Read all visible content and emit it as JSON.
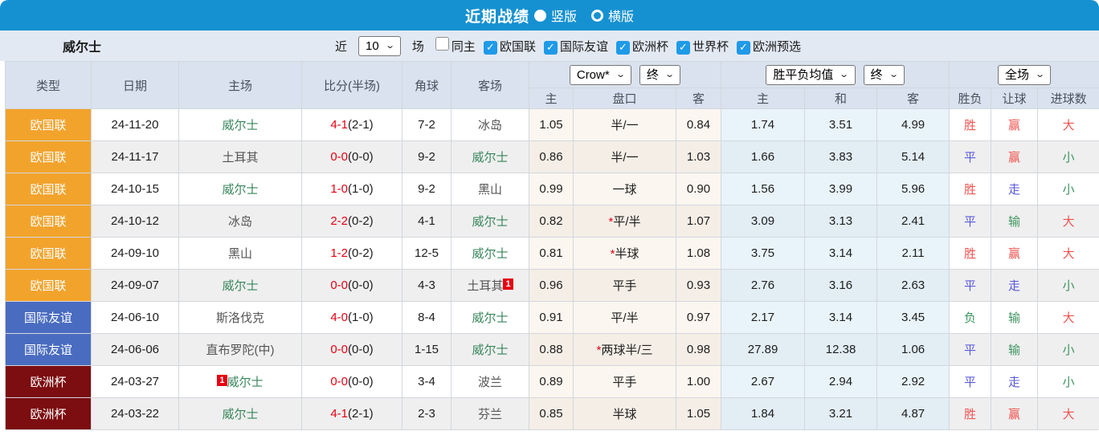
{
  "topbar": {
    "title": "近期战绩",
    "radios": [
      {
        "label": "竖版",
        "selected": true
      },
      {
        "label": "横版",
        "selected": false
      }
    ]
  },
  "filter": {
    "team": "威尔士",
    "near_label": "近",
    "count_select": "10",
    "matches_label": "场",
    "checkboxes": [
      {
        "label": "同主",
        "checked": false
      },
      {
        "label": "欧国联",
        "checked": true
      },
      {
        "label": "国际友谊",
        "checked": true
      },
      {
        "label": "欧洲杯",
        "checked": true
      },
      {
        "label": "世界杯",
        "checked": true
      },
      {
        "label": "欧洲预选",
        "checked": true
      }
    ]
  },
  "colors": {
    "topbar_blue": "#1591d2",
    "checkbox_blue": "#1e9ae8",
    "team_green": "#38865b",
    "score_red": "#e60012",
    "badge_red": "#e60012",
    "result": {
      "red": "#ef5350",
      "blue": "#5a5ae0",
      "green": "#3d9560"
    },
    "type": {
      "欧国联": "#f2a32c",
      "国际友谊": "#4a6cc0",
      "欧洲杯": "#7c0d10"
    }
  },
  "table": {
    "static_headers": [
      "类型",
      "日期",
      "主场",
      "比分(半场)",
      "角球",
      "客场"
    ],
    "odds_group": {
      "selects": [
        "Crow*",
        "终"
      ],
      "sub": [
        "主",
        "盘口",
        "客"
      ]
    },
    "avg_group": {
      "selects": [
        "胜平负均值",
        "终"
      ],
      "sub": [
        "主",
        "和",
        "客"
      ]
    },
    "result_group": {
      "selects": [
        "全场"
      ],
      "sub": [
        "胜负",
        "让球",
        "进球数"
      ]
    },
    "rows": [
      {
        "type": "欧国联",
        "date": "24-11-20",
        "home": {
          "name": "威尔士",
          "team": true
        },
        "score": {
          "full": "4-1",
          "half": "(2-1)"
        },
        "corner": "7-2",
        "away": {
          "name": "冰岛",
          "team": false
        },
        "odds": {
          "home": "1.05",
          "handicap": "半/一",
          "star": false,
          "away": "0.84"
        },
        "avg": {
          "home": "1.74",
          "draw": "3.51",
          "away": "4.99"
        },
        "result": {
          "wdl": {
            "text": "胜",
            "color": "red"
          },
          "handicap": {
            "text": "赢",
            "color": "red"
          },
          "goals": {
            "text": "大",
            "color": "red"
          }
        }
      },
      {
        "type": "欧国联",
        "date": "24-11-17",
        "home": {
          "name": "土耳其",
          "team": false
        },
        "score": {
          "full": "0-0",
          "half": "(0-0)"
        },
        "corner": "9-2",
        "away": {
          "name": "威尔士",
          "team": true
        },
        "odds": {
          "home": "0.86",
          "handicap": "半/一",
          "star": false,
          "away": "1.03"
        },
        "avg": {
          "home": "1.66",
          "draw": "3.83",
          "away": "5.14"
        },
        "result": {
          "wdl": {
            "text": "平",
            "color": "blue"
          },
          "handicap": {
            "text": "赢",
            "color": "red"
          },
          "goals": {
            "text": "小",
            "color": "green"
          }
        }
      },
      {
        "type": "欧国联",
        "date": "24-10-15",
        "home": {
          "name": "威尔士",
          "team": true
        },
        "score": {
          "full": "1-0",
          "half": "(1-0)"
        },
        "corner": "9-2",
        "away": {
          "name": "黑山",
          "team": false
        },
        "odds": {
          "home": "0.99",
          "handicap": "一球",
          "star": false,
          "away": "0.90"
        },
        "avg": {
          "home": "1.56",
          "draw": "3.99",
          "away": "5.96"
        },
        "result": {
          "wdl": {
            "text": "胜",
            "color": "red"
          },
          "handicap": {
            "text": "走",
            "color": "blue"
          },
          "goals": {
            "text": "小",
            "color": "green"
          }
        }
      },
      {
        "type": "欧国联",
        "date": "24-10-12",
        "home": {
          "name": "冰岛",
          "team": false
        },
        "score": {
          "full": "2-2",
          "half": "(0-2)"
        },
        "corner": "4-1",
        "away": {
          "name": "威尔士",
          "team": true
        },
        "odds": {
          "home": "0.82",
          "handicap": "平/半",
          "star": true,
          "away": "1.07"
        },
        "avg": {
          "home": "3.09",
          "draw": "3.13",
          "away": "2.41"
        },
        "result": {
          "wdl": {
            "text": "平",
            "color": "blue"
          },
          "handicap": {
            "text": "输",
            "color": "green"
          },
          "goals": {
            "text": "大",
            "color": "red"
          }
        }
      },
      {
        "type": "欧国联",
        "date": "24-09-10",
        "home": {
          "name": "黑山",
          "team": false
        },
        "score": {
          "full": "1-2",
          "half": "(0-2)"
        },
        "corner": "12-5",
        "away": {
          "name": "威尔士",
          "team": true
        },
        "odds": {
          "home": "0.81",
          "handicap": "半球",
          "star": true,
          "away": "1.08"
        },
        "avg": {
          "home": "3.75",
          "draw": "3.14",
          "away": "2.11"
        },
        "result": {
          "wdl": {
            "text": "胜",
            "color": "red"
          },
          "handicap": {
            "text": "赢",
            "color": "red"
          },
          "goals": {
            "text": "大",
            "color": "red"
          }
        }
      },
      {
        "type": "欧国联",
        "date": "24-09-07",
        "home": {
          "name": "威尔士",
          "team": true
        },
        "score": {
          "full": "0-0",
          "half": "(0-0)"
        },
        "corner": "4-3",
        "away": {
          "name": "土耳其",
          "team": false,
          "badge_after": "1"
        },
        "odds": {
          "home": "0.96",
          "handicap": "平手",
          "star": false,
          "away": "0.93"
        },
        "avg": {
          "home": "2.76",
          "draw": "3.16",
          "away": "2.63"
        },
        "result": {
          "wdl": {
            "text": "平",
            "color": "blue"
          },
          "handicap": {
            "text": "走",
            "color": "blue"
          },
          "goals": {
            "text": "小",
            "color": "green"
          }
        }
      },
      {
        "type": "国际友谊",
        "date": "24-06-10",
        "home": {
          "name": "斯洛伐克",
          "team": false
        },
        "score": {
          "full": "4-0",
          "half": "(1-0)"
        },
        "corner": "8-4",
        "away": {
          "name": "威尔士",
          "team": true
        },
        "odds": {
          "home": "0.91",
          "handicap": "平/半",
          "star": false,
          "away": "0.97"
        },
        "avg": {
          "home": "2.17",
          "draw": "3.14",
          "away": "3.45"
        },
        "result": {
          "wdl": {
            "text": "负",
            "color": "green"
          },
          "handicap": {
            "text": "输",
            "color": "green"
          },
          "goals": {
            "text": "大",
            "color": "red"
          }
        }
      },
      {
        "type": "国际友谊",
        "date": "24-06-06",
        "home": {
          "name": "直布罗陀(中)",
          "team": false
        },
        "score": {
          "full": "0-0",
          "half": "(0-0)"
        },
        "corner": "1-15",
        "away": {
          "name": "威尔士",
          "team": true
        },
        "odds": {
          "home": "0.88",
          "handicap": "两球半/三",
          "star": true,
          "away": "0.98"
        },
        "avg": {
          "home": "27.89",
          "draw": "12.38",
          "away": "1.06"
        },
        "result": {
          "wdl": {
            "text": "平",
            "color": "blue"
          },
          "handicap": {
            "text": "输",
            "color": "green"
          },
          "goals": {
            "text": "小",
            "color": "green"
          }
        }
      },
      {
        "type": "欧洲杯",
        "date": "24-03-27",
        "home": {
          "name": "威尔士",
          "team": true,
          "badge_before": "1"
        },
        "score": {
          "full": "0-0",
          "half": "(0-0)"
        },
        "corner": "3-4",
        "away": {
          "name": "波兰",
          "team": false
        },
        "odds": {
          "home": "0.89",
          "handicap": "平手",
          "star": false,
          "away": "1.00"
        },
        "avg": {
          "home": "2.67",
          "draw": "2.94",
          "away": "2.92"
        },
        "result": {
          "wdl": {
            "text": "平",
            "color": "blue"
          },
          "handicap": {
            "text": "走",
            "color": "blue"
          },
          "goals": {
            "text": "小",
            "color": "green"
          }
        }
      },
      {
        "type": "欧洲杯",
        "date": "24-03-22",
        "home": {
          "name": "威尔士",
          "team": true
        },
        "score": {
          "full": "4-1",
          "half": "(2-1)"
        },
        "corner": "2-3",
        "away": {
          "name": "芬兰",
          "team": false
        },
        "odds": {
          "home": "0.85",
          "handicap": "半球",
          "star": false,
          "away": "1.05"
        },
        "avg": {
          "home": "1.84",
          "draw": "3.21",
          "away": "4.87"
        },
        "result": {
          "wdl": {
            "text": "胜",
            "color": "red"
          },
          "handicap": {
            "text": "赢",
            "color": "red"
          },
          "goals": {
            "text": "大",
            "color": "red"
          }
        }
      }
    ]
  }
}
